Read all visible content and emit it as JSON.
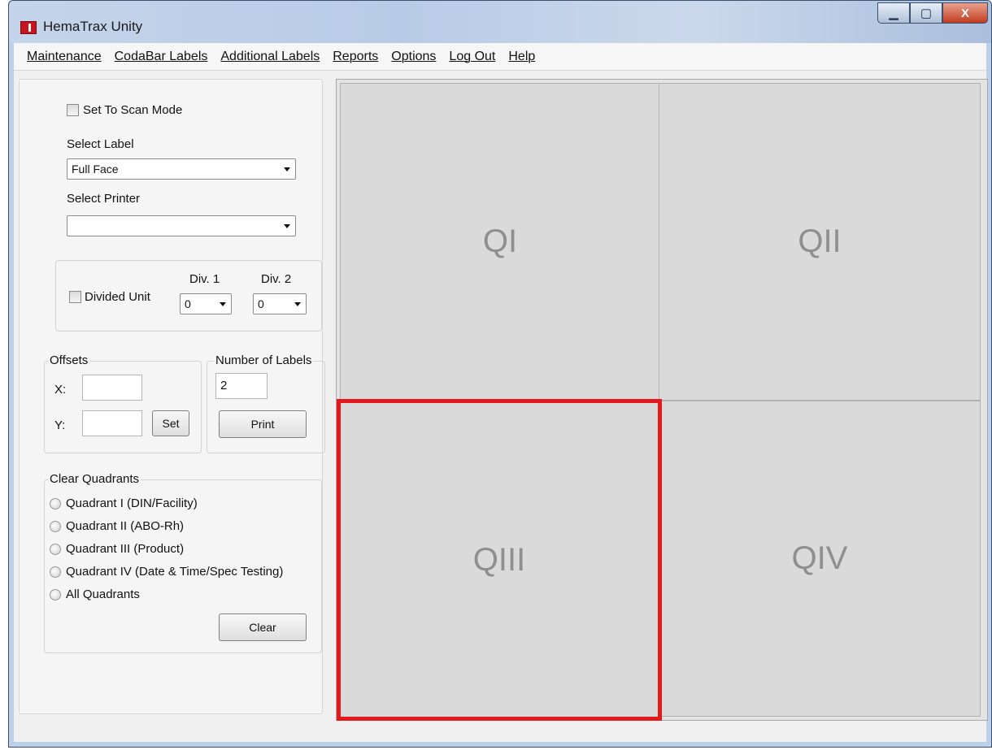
{
  "window": {
    "title": "HemaTrax Unity",
    "minimize_glyph": "▁",
    "maximize_glyph": "▢",
    "close_glyph": "X"
  },
  "menu": [
    "Maintenance",
    "CodaBar Labels",
    "Additional Labels",
    "Reports",
    "Options",
    "Log Out",
    "Help"
  ],
  "left": {
    "scan_mode_label": "Set To Scan Mode",
    "select_label_heading": "Select Label",
    "select_label_value": "Full Face",
    "select_printer_heading": "Select Printer",
    "select_printer_value": "",
    "divided_unit_label": "Divided Unit",
    "div1_label": "Div. 1",
    "div1_value": "0",
    "div2_label": "Div. 2",
    "div2_value": "0",
    "offsets_title": "Offsets",
    "x_label": "X:",
    "x_value": "",
    "y_label": "Y:",
    "y_value": "",
    "set_button": "Set",
    "num_labels_title": "Number of Labels",
    "num_labels_value": "2",
    "print_button": "Print",
    "clear_title": "Clear Quadrants",
    "clear_options": [
      "Quadrant I (DIN/Facility)",
      "Quadrant II (ABO-Rh)",
      "Quadrant III (Product)",
      "Quadrant IV (Date & Time/Spec Testing)",
      "All Quadrants"
    ],
    "clear_button": "Clear"
  },
  "quadrants": {
    "q1": "QI",
    "q2": "QII",
    "q3": "QIII",
    "q4": "QIV",
    "selected": "QIII"
  },
  "colors": {
    "selection_border": "#e4191c",
    "quadrant_bg": "#dadadb",
    "quadrant_text": "#8f8f8f"
  }
}
